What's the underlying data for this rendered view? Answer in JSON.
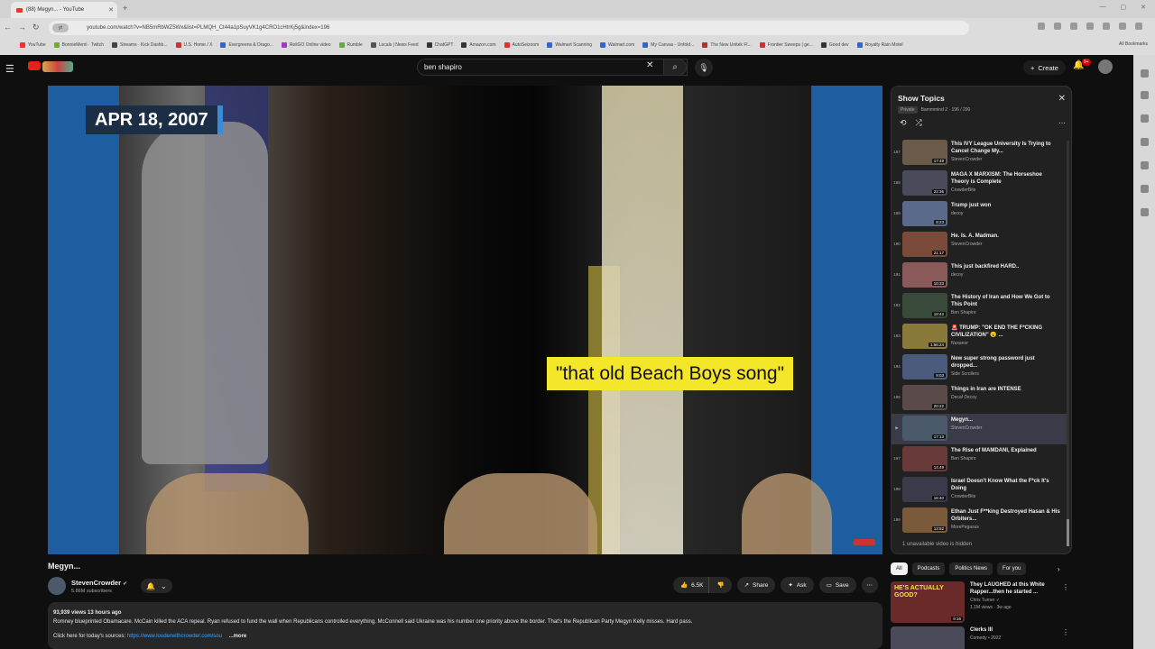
{
  "browser": {
    "tab_title": "(88) Megyn... - YouTube",
    "url_chip": "yt",
    "url": "youtube.com/watch?v=NB5mRbWZ5Wx&list=PLMQH_Ct44a1pSuyVK1g4CRO1cHtrKj5g&index=196",
    "bookmarks": [
      "YouTube",
      "BonnieMemi · Twitch",
      "Streams · Kick Dashb...",
      "U.S. Home / X",
      "Evergreens & Drago...",
      "ReliGO Online video",
      "Rumble",
      "Locals | News Feed",
      "ChatGPT",
      "Amazon.com",
      "AutoSeizoom",
      "Walmart Scanning",
      "Walmart.com",
      "My Canvas - Unfold...",
      "The New Unitek Fl...",
      "Frontier Sweeps | ge...",
      "Good dev",
      "Royalty Rain Motel"
    ],
    "all_bookmarks": "All Bookmarks"
  },
  "masthead": {
    "search_value": "ben shapiro",
    "create_label": "Create",
    "notif_count": "9+"
  },
  "video": {
    "date_caption": "APR 18, 2007",
    "subtitle_caption": "\"that old Beach Boys song\"",
    "title": "Megyn...",
    "channel": "StevenCrowder",
    "subscribers": "5.86M subscribers",
    "likes": "6.5K",
    "share_label": "Share",
    "ask_label": "Ask",
    "save_label": "Save"
  },
  "description": {
    "meta": "93,939 views  13 hours ago",
    "text": "Romney blueprinted Obamacare. McCain killed the ACA repeal. Ryan refused to fund the wall when Republicans controlled everything. McConnell said Ukraine was his number one priority above the border. That's the Republican Party Megyn Kelly misses. Hard pass.",
    "sources_prefix": "Click here for today's sources:",
    "sources_link": "https://www.louderwithcrowder.com/sou",
    "more": "...more"
  },
  "playlist": {
    "title": "Show Topics",
    "privacy": "Private",
    "meta": "Bammmind 2 · 196 / 200",
    "hidden_note": "1 unavailable video is hidden",
    "items": [
      {
        "index": "187",
        "title": "This IVY League University Is Trying to Cancel Change My...",
        "channel": "StevenCrowder",
        "duration": "17:49",
        "color": "#6a5a4a"
      },
      {
        "index": "188",
        "title": "MAGA X MARXISM: The Horseshoe Theory is Complete",
        "channel": "CrowderBits",
        "duration": "22:36",
        "color": "#4a4a5a"
      },
      {
        "index": "189",
        "title": "Trump just won",
        "channel": "decoy",
        "duration": "8:23",
        "color": "#5a6a8a"
      },
      {
        "index": "190",
        "title": "He. Is. A. Madman.",
        "channel": "StevenCrowder",
        "duration": "21:17",
        "color": "#7a4a3a"
      },
      {
        "index": "191",
        "title": "This just backfired HARD..",
        "channel": "decoy",
        "duration": "10:33",
        "color": "#8a5a5a"
      },
      {
        "index": "192",
        "title": "The History of Iran and How We Got to This Point",
        "channel": "Ben Shapiro",
        "duration": "18:43",
        "color": "#3a4a3a"
      },
      {
        "index": "193",
        "title": "🚨 TRUMP: \"OK END THE F*CKING CIVILIZATION\" 😮 ...",
        "channel": "Nuxanor",
        "duration": "1:56:24",
        "color": "#8a7a3a"
      },
      {
        "index": "194",
        "title": "New super strong password just dropped...",
        "channel": "Side Scrollers",
        "duration": "9:03",
        "color": "#4a5a7a"
      },
      {
        "index": "195",
        "title": "Things in Iran are INTENSE",
        "channel": "Decaf Decoy",
        "duration": "20:22",
        "color": "#5a4a4a"
      },
      {
        "index": "▶",
        "title": "Megyn...",
        "channel": "StevenCrowder",
        "duration": "17:13",
        "color": "#4a5a6a",
        "active": true
      },
      {
        "index": "197",
        "title": "The Rise of MAMDANI, Explained",
        "channel": "Ben Shapiro",
        "duration": "14:49",
        "color": "#6a3a3a"
      },
      {
        "index": "198",
        "title": "Israel Doesn't Know What the F*ck It's Doing",
        "channel": "CrowderBits",
        "duration": "18:40",
        "color": "#3a3a4a"
      },
      {
        "index": "199",
        "title": "Ethan Just F**king Destroyed Hasan & His Orbiters...",
        "channel": "MorePegasus",
        "duration": "13:52",
        "color": "#7a5a3a"
      }
    ]
  },
  "chips": [
    "All",
    "Podcasts",
    "Politics News",
    "For you"
  ],
  "recommendations": [
    {
      "title": "They LAUGHED at this White Rapper...then he started ...",
      "channel": "Chris Turner ✓",
      "meta": "1.1M views · 3w ago",
      "duration": "9:16",
      "thumb_text": "HE'S ACTUALLY GOOD?",
      "color": "#6a2a2a"
    },
    {
      "title": "Clerks III",
      "channel": "Comedy • 2022",
      "meta": "",
      "duration": "",
      "thumb_text": "",
      "color": "#4a4a5a"
    }
  ]
}
